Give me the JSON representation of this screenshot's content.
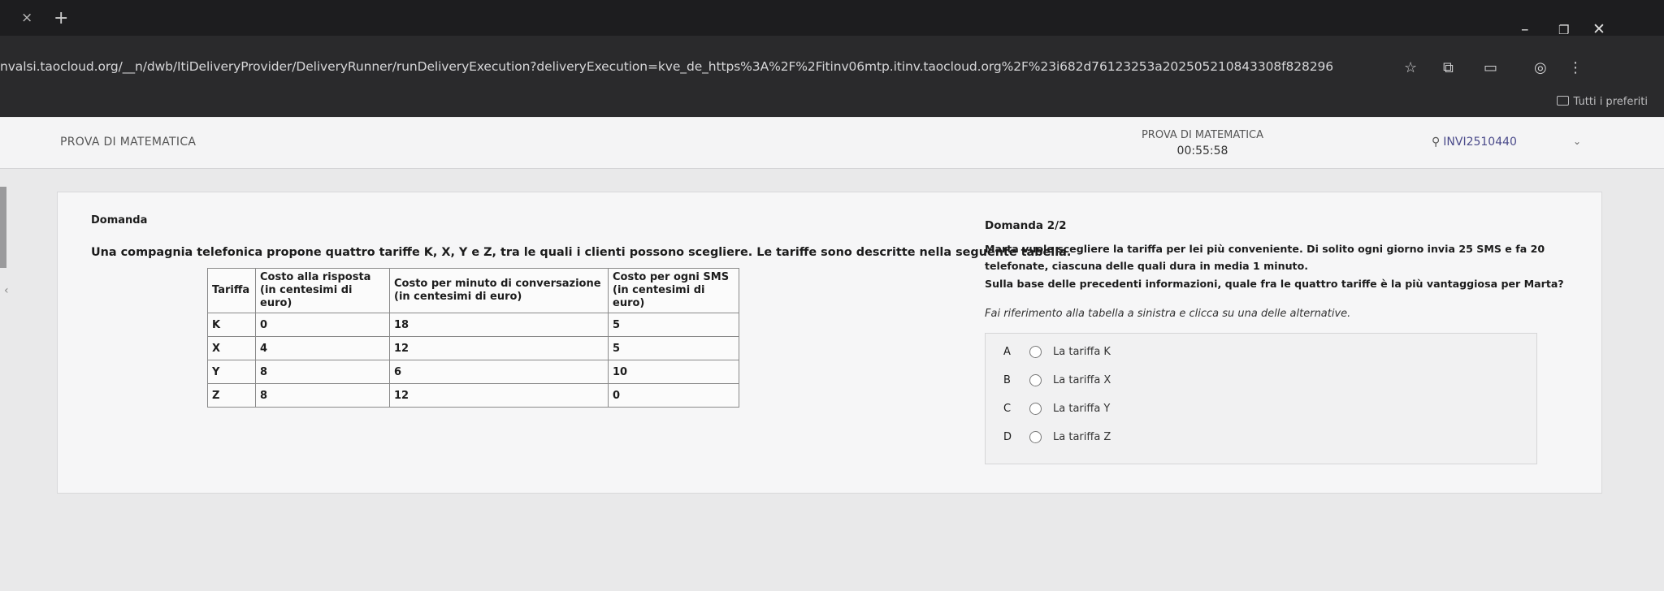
{
  "browser": {
    "tab_close_glyph": "×",
    "tab_new_glyph": "+",
    "url": "nvalsi.taocloud.org/__n/dwb/ItiDeliveryProvider/DeliveryRunner/runDeliveryExecution?deliveryExecution=kve_de_https%3A%2F%2Fitinv06mtp.itinv.taocloud.org%2F%23i682d76123253a2025052108433​08f828296",
    "bookmarks_label": "Tutti i preferiti",
    "icons": [
      "star-icon",
      "extensions-icon",
      "cast-icon",
      "profile-icon",
      "more-icon"
    ]
  },
  "header": {
    "brand": "PROVA DI MATEMATICA",
    "title": "PROVA DI MATEMATICA",
    "timer": "00:55:58",
    "user": "INVI2510440"
  },
  "question": {
    "label": "Domanda",
    "text": "Una compagnia telefonica propone quattro tariffe K, X, Y e Z, tra le quali i clienti possono scegliere. Le tariffe sono descritte nella seguente tabella.",
    "table": {
      "headers": [
        [
          "Tariffa"
        ],
        [
          "Costo alla risposta",
          "(in centesimi di euro)"
        ],
        [
          "Costo per minuto di conversazione",
          "(in centesimi di euro)"
        ],
        [
          "Costo per ogni SMS",
          "(in centesimi di euro)"
        ]
      ],
      "rows": [
        [
          "K",
          "0",
          "18",
          "5"
        ],
        [
          "X",
          "4",
          "12",
          "5"
        ],
        [
          "Y",
          "8",
          "6",
          "10"
        ],
        [
          "Z",
          "8",
          "12",
          "0"
        ]
      ]
    }
  },
  "subquestion": {
    "label": "Domanda 2/2",
    "text1": "Marta vuole scegliere la tariffa per lei più conveniente. Di solito ogni giorno invia 25 SMS e fa 20",
    "text2": "telefonate, ciascuna delle quali dura in media 1 minuto.",
    "text3": "Sulla base delle precedenti informazioni, quale fra le quattro tariffe è la più vantaggiosa per Marta?",
    "instruction": "Fai riferimento alla tabella a sinistra e clicca su una delle alternative.",
    "choices": [
      {
        "letter": "A",
        "label": "La tariffa K"
      },
      {
        "letter": "B",
        "label": "La tariffa X"
      },
      {
        "letter": "C",
        "label": "La tariffa Y"
      },
      {
        "letter": "D",
        "label": "La tariffa Z"
      }
    ]
  }
}
